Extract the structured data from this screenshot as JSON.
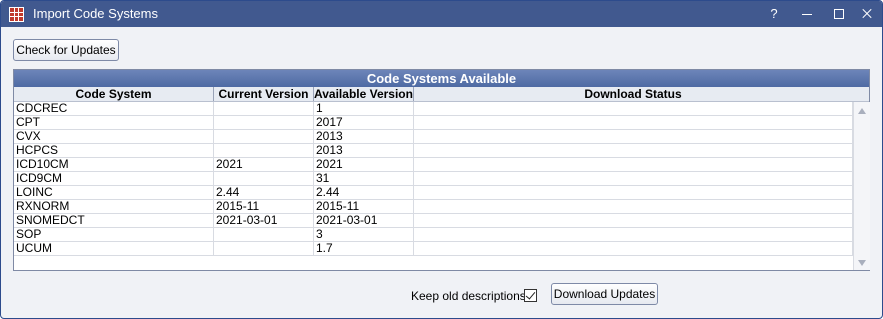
{
  "window": {
    "title": "Import Code Systems",
    "help_label": "?"
  },
  "toolbar": {
    "check_updates_label": "Check for Updates"
  },
  "grid": {
    "title": "Code Systems Available",
    "columns": [
      "Code System",
      "Current Version",
      "Available Version",
      "Download Status"
    ],
    "rows": [
      {
        "code_system": "CDCREC",
        "current": "",
        "available": "1",
        "status": ""
      },
      {
        "code_system": "CPT",
        "current": "",
        "available": "2017",
        "status": ""
      },
      {
        "code_system": "CVX",
        "current": "",
        "available": "2013",
        "status": ""
      },
      {
        "code_system": "HCPCS",
        "current": "",
        "available": "2013",
        "status": ""
      },
      {
        "code_system": "ICD10CM",
        "current": "2021",
        "available": "2021",
        "status": ""
      },
      {
        "code_system": "ICD9CM",
        "current": "",
        "available": "31",
        "status": ""
      },
      {
        "code_system": "LOINC",
        "current": "2.44",
        "available": "2.44",
        "status": ""
      },
      {
        "code_system": "RXNORM",
        "current": "2015-11",
        "available": "2015-11",
        "status": ""
      },
      {
        "code_system": "SNOMEDCT",
        "current": "2021-03-01",
        "available": "2021-03-01",
        "status": ""
      },
      {
        "code_system": "SOP",
        "current": "",
        "available": "3",
        "status": ""
      },
      {
        "code_system": "UCUM",
        "current": "",
        "available": "1.7",
        "status": ""
      }
    ]
  },
  "footer": {
    "keep_old_descriptions_label": "Keep old descriptions",
    "keep_old_descriptions_checked": true,
    "download_updates_label": "Download Updates"
  },
  "colors": {
    "titlebar": "#41598f",
    "grid_header": "#4e6aa3"
  }
}
